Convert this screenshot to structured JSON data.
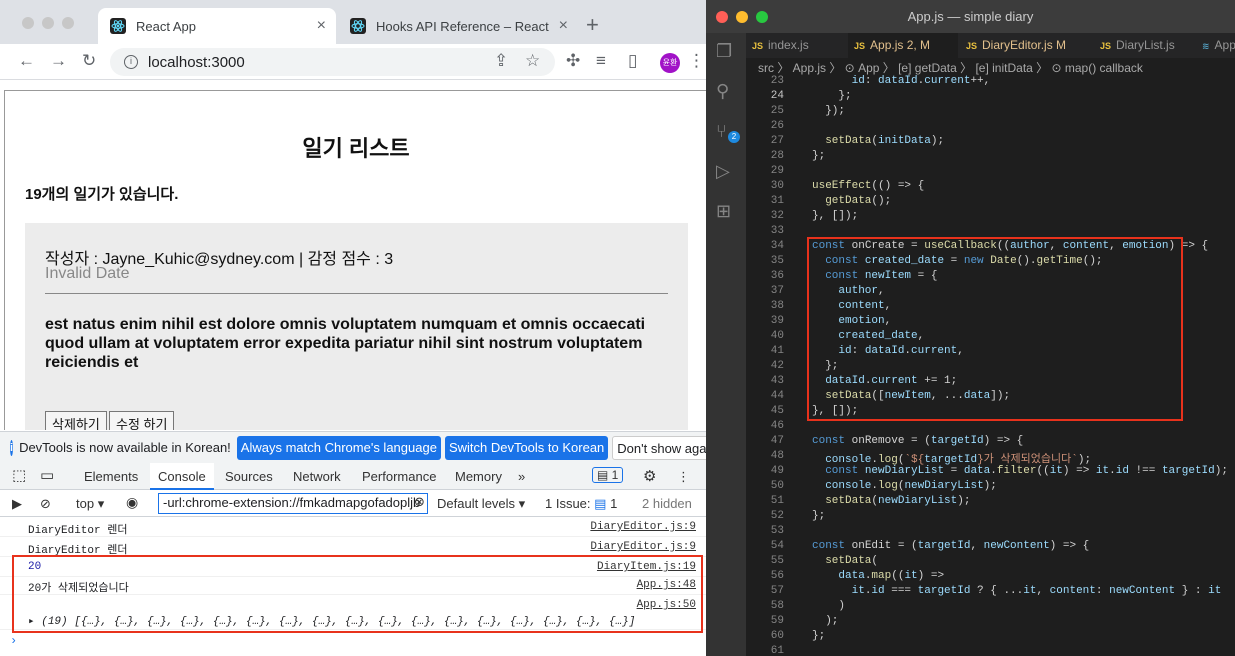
{
  "browser": {
    "tabs": [
      {
        "label": "React App",
        "active": true
      },
      {
        "label": "Hooks API Reference – React",
        "active": false
      }
    ],
    "url": "localhost:3000",
    "avatar": "윤환"
  },
  "page": {
    "title": "일기 리스트",
    "count_text": "19개의 일기가 있습니다.",
    "item": {
      "meta": "작성자 : Jayne_Kuhic@sydney.com | 감정 점수 : 3",
      "date": "Invalid Date",
      "content": "est natus enim nihil est dolore omnis voluptatem numquam et omnis occaecati quod ullam at voluptatem error expedita pariatur nihil sint nostrum voluptatem reiciendis et",
      "delete_label": "삭제하기",
      "edit_label": "수정 하기"
    }
  },
  "devtools": {
    "notice": {
      "text": "DevTools is now available in Korean!",
      "btn_match": "Always match Chrome's language",
      "btn_switch": "Switch DevTools to Korean",
      "btn_dismiss": "Don't show again"
    },
    "tabs": [
      "Elements",
      "Console",
      "Sources",
      "Network",
      "Performance",
      "Memory"
    ],
    "issues_badge": "1",
    "filter": {
      "context": "top",
      "value": "-url:chrome-extension://fmkadmapgofadopljb",
      "levels": "Default levels",
      "issues": "1 Issue:",
      "issues_count": "1",
      "hidden": "2 hidden"
    },
    "logs": [
      {
        "msg": "DiaryEditor 렌더",
        "src": "DiaryEditor.js:9"
      },
      {
        "msg": "DiaryEditor 렌더",
        "src": "DiaryEditor.js:9"
      },
      {
        "msg": "20",
        "src": "DiaryItem.js:19"
      },
      {
        "msg": "20가 삭제되었습니다",
        "src": "App.js:48"
      },
      {
        "msg": "",
        "src": "App.js:50"
      },
      {
        "msg": "▸ (19) [{…}, {…}, {…}, {…}, {…}, {…}, {…}, {…}, {…}, {…}, {…}, {…}, {…}, {…}, {…}, {…}, {…}]",
        "src": ""
      }
    ],
    "prompt": "›"
  },
  "vscode": {
    "title": "App.js — simple diary",
    "tabs": [
      {
        "label": "index.js",
        "mod": ""
      },
      {
        "label": "App.js",
        "mod": "2, M"
      },
      {
        "label": "DiaryEditor.js",
        "mod": "M"
      },
      {
        "label": "DiaryList.js",
        "mod": ""
      },
      {
        "label": "App",
        "mod": ""
      }
    ],
    "breadcrumb": "src 〉 App.js 〉 ⊙ App 〉 [e] getData 〉 [e] initData 〉 ⊙ map() callback",
    "scm_badge": "2",
    "lines": [
      {
        "n": "23",
        "t": "      id: dataId.current++,"
      },
      {
        "n": "24",
        "t": "    };"
      },
      {
        "n": "25",
        "t": "  });"
      },
      {
        "n": "26",
        "t": ""
      },
      {
        "n": "27",
        "t": "  setData(initData);"
      },
      {
        "n": "28",
        "t": "};"
      },
      {
        "n": "29",
        "t": ""
      },
      {
        "n": "30",
        "t": "useEffect(() => {"
      },
      {
        "n": "31",
        "t": "  getData();"
      },
      {
        "n": "32",
        "t": "}, []);"
      },
      {
        "n": "33",
        "t": ""
      },
      {
        "n": "34",
        "t": "const onCreate = useCallback((author, content, emotion) => {"
      },
      {
        "n": "35",
        "t": "  const created_date = new Date().getTime();"
      },
      {
        "n": "36",
        "t": "  const newItem = {"
      },
      {
        "n": "37",
        "t": "    author,"
      },
      {
        "n": "38",
        "t": "    content,"
      },
      {
        "n": "39",
        "t": "    emotion,"
      },
      {
        "n": "40",
        "t": "    created_date,"
      },
      {
        "n": "41",
        "t": "    id: dataId.current,"
      },
      {
        "n": "42",
        "t": "  };"
      },
      {
        "n": "43",
        "t": "  dataId.current += 1;"
      },
      {
        "n": "44",
        "t": "  setData([newItem, ...data]);"
      },
      {
        "n": "45",
        "t": "}, []);"
      },
      {
        "n": "46",
        "t": ""
      },
      {
        "n": "47",
        "t": "const onRemove = (targetId) => {"
      },
      {
        "n": "48",
        "t": "  console.log(`${targetId}가 삭제되었습니다`);"
      },
      {
        "n": "49",
        "t": "  const newDiaryList = data.filter((it) => it.id !== targetId);"
      },
      {
        "n": "50",
        "t": "  console.log(newDiaryList);"
      },
      {
        "n": "51",
        "t": "  setData(newDiaryList);"
      },
      {
        "n": "52",
        "t": "};"
      },
      {
        "n": "53",
        "t": ""
      },
      {
        "n": "54",
        "t": "const onEdit = (targetId, newContent) => {"
      },
      {
        "n": "55",
        "t": "  setData("
      },
      {
        "n": "56",
        "t": "    data.map((it) =>"
      },
      {
        "n": "57",
        "t": "      it.id === targetId ? { ...it, content: newContent } : it"
      },
      {
        "n": "58",
        "t": "    )"
      },
      {
        "n": "59",
        "t": "  );"
      },
      {
        "n": "60",
        "t": "};"
      },
      {
        "n": "61",
        "t": ""
      }
    ]
  },
  "colors": {
    "accent": "#1a73e8",
    "highlight_box": "#e8321c"
  }
}
